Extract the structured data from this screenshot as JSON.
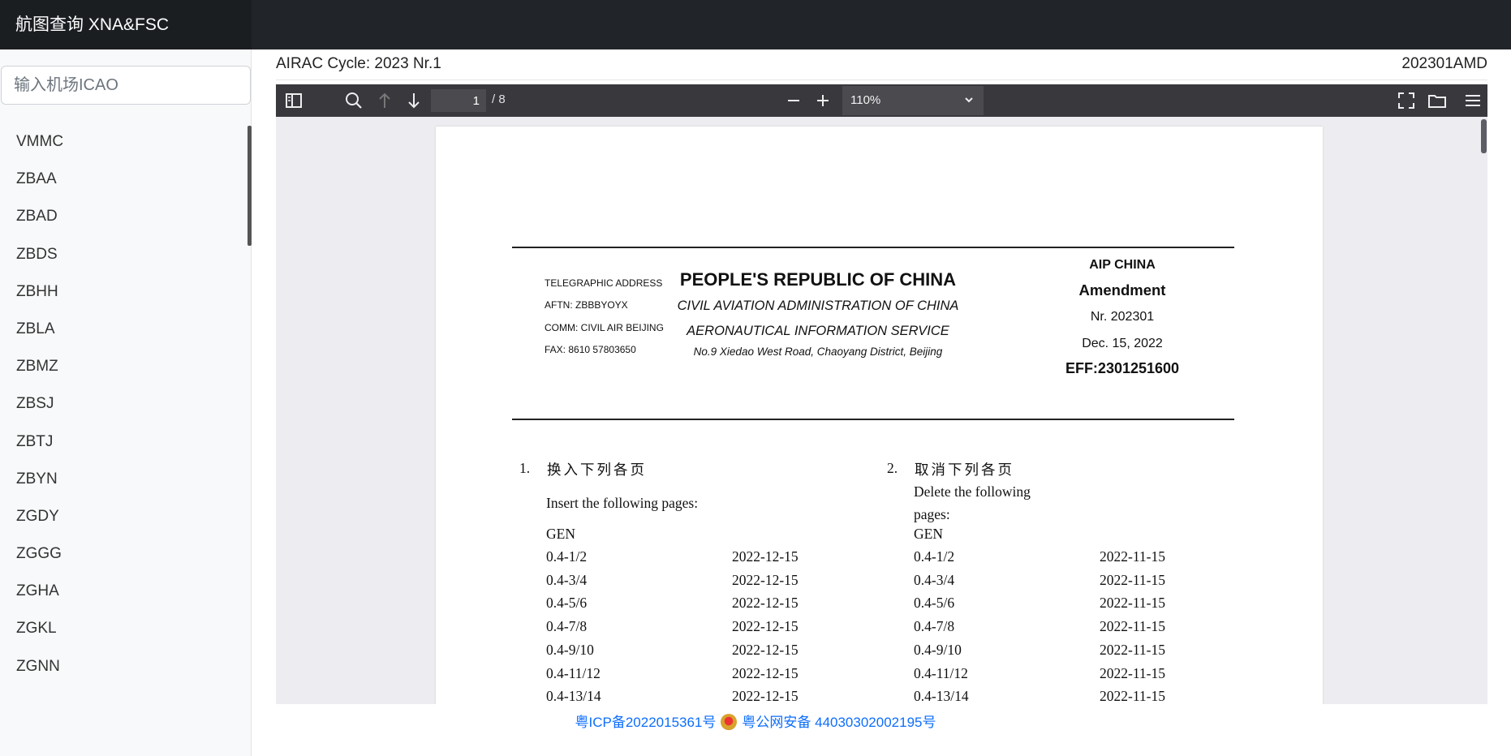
{
  "header": {
    "brand": "航图查询 XNA&FSC"
  },
  "sidebar": {
    "search_placeholder": "输入机场ICAO",
    "airports": [
      "VMMC",
      "ZBAA",
      "ZBAD",
      "ZBDS",
      "ZBHH",
      "ZBLA",
      "ZBMZ",
      "ZBSJ",
      "ZBTJ",
      "ZBYN",
      "ZGDY",
      "ZGGG",
      "ZGHA",
      "ZGKL",
      "ZGNN"
    ]
  },
  "info": {
    "cycle": "AIRAC Cycle: 2023 Nr.1",
    "doc_id": "202301AMD"
  },
  "pdf_toolbar": {
    "page_value": "1",
    "page_count": "/ 8",
    "zoom": "110%",
    "icons": [
      "sidebar-toggle-icon",
      "search-icon",
      "arrow-up-icon",
      "arrow-down-icon",
      "minus-icon",
      "plus-icon",
      "fullscreen-icon",
      "folder-icon",
      "menu-icon"
    ]
  },
  "document": {
    "telegraphic": [
      "TELEGRAPHIC ADDRESS",
      "AFTN: ZBBBYOYX",
      "COMM: CIVIL AIR BEIJING",
      "FAX: 8610 57803650"
    ],
    "title": "PEOPLE'S REPUBLIC OF CHINA",
    "caac": "CIVIL AVIATION ADMINISTRATION OF CHINA",
    "ais": "AERONAUTICAL INFORMATION SERVICE",
    "address": "No.9 Xiedao West Road, Chaoyang District, Beijing",
    "aip": "AIP CHINA",
    "amendment": "Amendment",
    "nr": "Nr. 202301",
    "date": "Dec. 15, 2022",
    "eff": "EFF:2301251600",
    "section1": {
      "num": "1.",
      "cn": "换入下列各页",
      "en": "Insert the following pages:",
      "group": "GEN",
      "rows": [
        [
          "0.4-1/2",
          "2022-12-15"
        ],
        [
          "0.4-3/4",
          "2022-12-15"
        ],
        [
          "0.4-5/6",
          "2022-12-15"
        ],
        [
          "0.4-7/8",
          "2022-12-15"
        ],
        [
          "0.4-9/10",
          "2022-12-15"
        ],
        [
          "0.4-11/12",
          "2022-12-15"
        ],
        [
          "0.4-13/14",
          "2022-12-15"
        ]
      ]
    },
    "section2": {
      "num": "2.",
      "cn": "取消下列各页",
      "en1": "Delete the following",
      "en2": "pages:",
      "group": "GEN",
      "rows": [
        [
          "0.4-1/2",
          "2022-11-15"
        ],
        [
          "0.4-3/4",
          "2022-11-15"
        ],
        [
          "0.4-5/6",
          "2022-11-15"
        ],
        [
          "0.4-7/8",
          "2022-11-15"
        ],
        [
          "0.4-9/10",
          "2022-11-15"
        ],
        [
          "0.4-11/12",
          "2022-11-15"
        ],
        [
          "0.4-13/14",
          "2022-11-15"
        ]
      ]
    }
  },
  "footer": {
    "icp": "粤ICP备2022015361号",
    "police": "粤公网安备 44030302002195号"
  }
}
